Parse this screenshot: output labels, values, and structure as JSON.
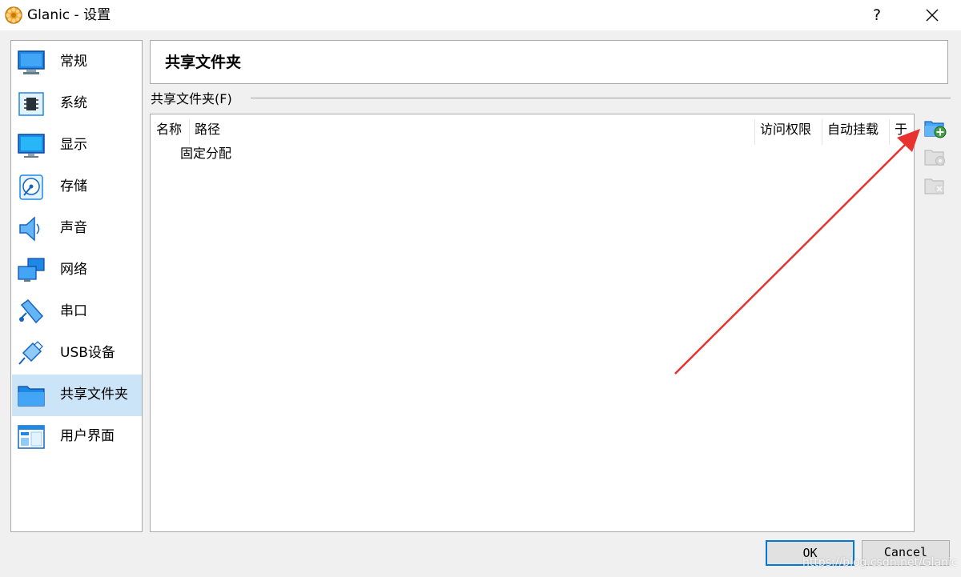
{
  "window": {
    "title": "Glanic - 设置",
    "help_label": "?",
    "app_icon": "virtualbox-gear-icon"
  },
  "sidebar": {
    "items": [
      {
        "label": "常规",
        "icon": "general-monitor-icon"
      },
      {
        "label": "系统",
        "icon": "system-chip-icon"
      },
      {
        "label": "显示",
        "icon": "display-monitor-icon"
      },
      {
        "label": "存储",
        "icon": "storage-disk-icon"
      },
      {
        "label": "声音",
        "icon": "audio-speaker-icon"
      },
      {
        "label": "网络",
        "icon": "network-monitors-icon"
      },
      {
        "label": "串口",
        "icon": "serial-port-icon"
      },
      {
        "label": "USB设备",
        "icon": "usb-plug-icon"
      },
      {
        "label": "共享文件夹",
        "icon": "shared-folder-icon",
        "selected": true
      },
      {
        "label": "用户界面",
        "icon": "user-interface-window-icon"
      }
    ]
  },
  "main": {
    "page_title": "共享文件夹",
    "group_label": "共享文件夹(F)",
    "columns": [
      "名称",
      "路径",
      "访问权限",
      "自动挂载",
      "于"
    ],
    "group_row": "固定分配",
    "toolbar": [
      "add-shared-folder-icon",
      "edit-shared-folder-icon",
      "remove-shared-folder-icon"
    ]
  },
  "buttons": {
    "ok": "OK",
    "cancel": "Cancel"
  },
  "watermark": "https://blog.csdn.net/Glanic",
  "colors": {
    "selection": "#cce4f7",
    "accent": "#0078d7",
    "annotation_arrow": "#e8322f"
  }
}
